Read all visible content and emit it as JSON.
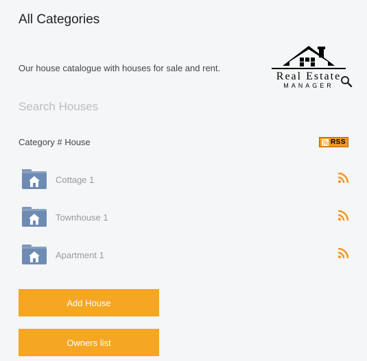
{
  "title": "All Categories",
  "subtitle": "Our house catalogue with houses for sale and rent.",
  "logo": {
    "line1": "Real Estate",
    "line2": "MANAGER"
  },
  "search": {
    "placeholder": "Search Houses"
  },
  "category_header": {
    "label": "Category # House",
    "rss_label": "RSS"
  },
  "categories": [
    {
      "name": "Cottage",
      "count": "1"
    },
    {
      "name": "Townhouse",
      "count": "1"
    },
    {
      "name": "Apartment",
      "count": "1"
    }
  ],
  "buttons": {
    "add_house": "Add House",
    "owners_list": "Owners list"
  }
}
